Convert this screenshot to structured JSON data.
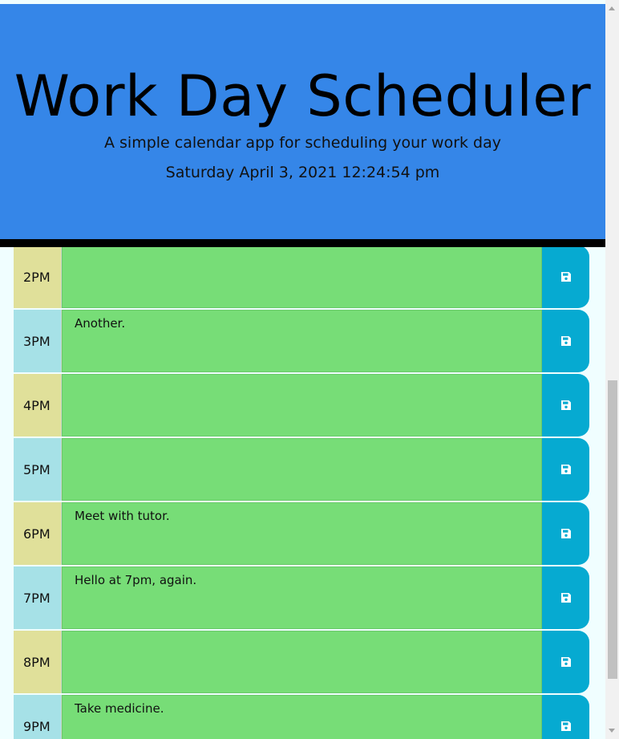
{
  "header": {
    "title": "Work Day Scheduler",
    "lead": "A simple calendar app for scheduling your work day",
    "current_date": "Saturday April 3, 2021 12:24:54 pm"
  },
  "rows": [
    {
      "hour": "2PM",
      "text": ""
    },
    {
      "hour": "3PM",
      "text": "Another."
    },
    {
      "hour": "4PM",
      "text": ""
    },
    {
      "hour": "5PM",
      "text": ""
    },
    {
      "hour": "6PM",
      "text": "Meet with tutor."
    },
    {
      "hour": "7PM",
      "text": "Hello at 7pm, again."
    },
    {
      "hour": "8PM",
      "text": ""
    },
    {
      "hour": "9PM",
      "text": "Take medicine."
    }
  ],
  "icons": {
    "save": "floppy-disk-icon"
  },
  "colors": {
    "header_bg": "#3586e8",
    "future_row": "#77dd77",
    "save_button": "#06aad1",
    "hour_even": "#e0e09a",
    "hour_odd": "#a6e1e7"
  }
}
